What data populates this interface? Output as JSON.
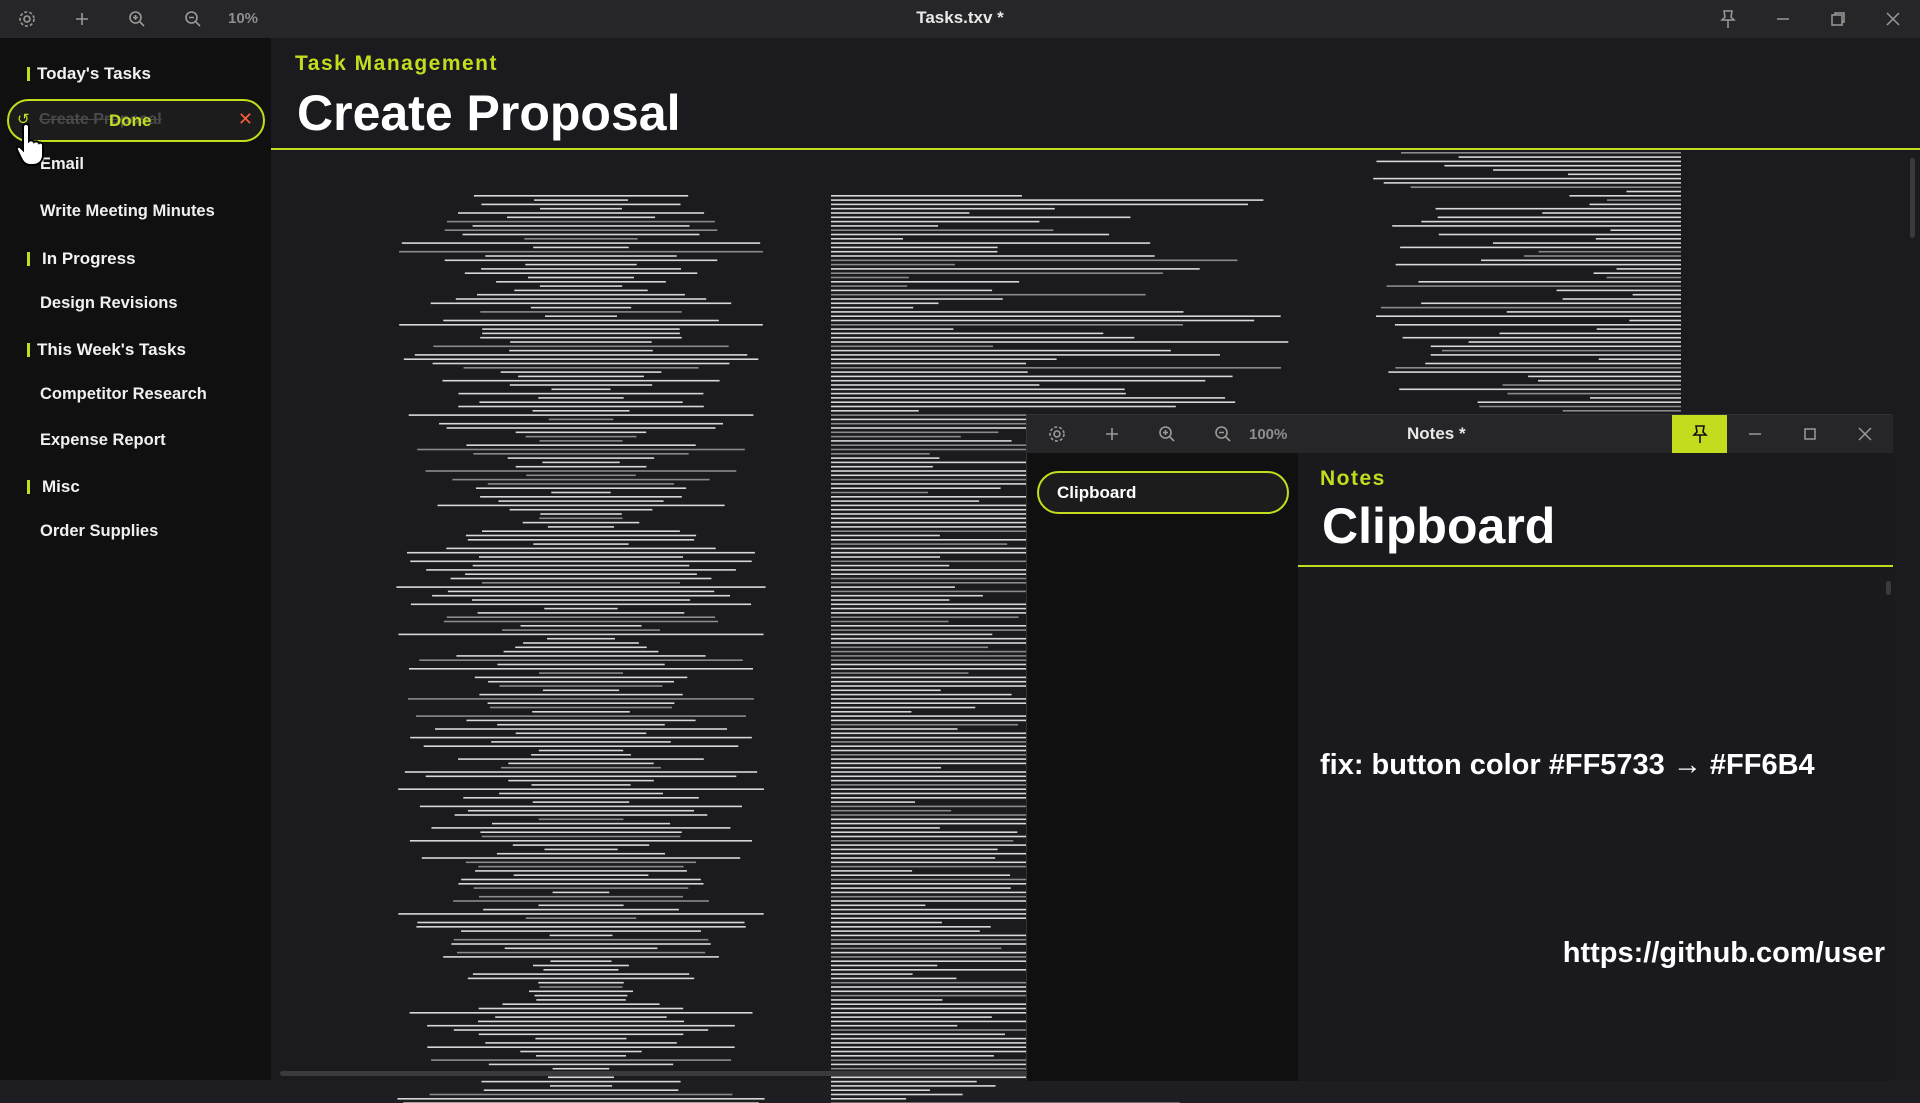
{
  "main_window": {
    "title": "Tasks.txv *",
    "zoom": "10%",
    "icons": [
      "gear-icon",
      "plus-icon",
      "zoom-in-icon",
      "zoom-out-icon",
      "pin-icon",
      "minimize-icon",
      "restore-icon",
      "close-icon"
    ]
  },
  "sidebar": {
    "sections": [
      {
        "label": "Today's Tasks"
      },
      {
        "label": "In Progress"
      },
      {
        "label": "This Week's Tasks"
      },
      {
        "label": "Misc"
      }
    ],
    "selected_item": {
      "label": "Create Proposal",
      "action_label": "Done"
    },
    "items": [
      {
        "label": "Email"
      },
      {
        "label": "Write Meeting Minutes"
      },
      {
        "label": "Design Revisions"
      },
      {
        "label": "Competitor Research"
      },
      {
        "label": "Expense Report"
      },
      {
        "label": "Order Supplies"
      }
    ]
  },
  "content": {
    "category": "Task Management",
    "title": "Create Proposal"
  },
  "notes_window": {
    "title": "Notes *",
    "zoom": "100%",
    "sidebar_item": "Clipboard",
    "category": "Notes",
    "heading": "Clipboard",
    "lines": [
      "fix: button color #FF5733 → #FF6B4",
      "https://github.com/user"
    ]
  },
  "colors": {
    "accent": "#c4dc1e",
    "close_x": "#ff5a3c",
    "background": "#1b1b1f",
    "sidebar": "#101010"
  }
}
